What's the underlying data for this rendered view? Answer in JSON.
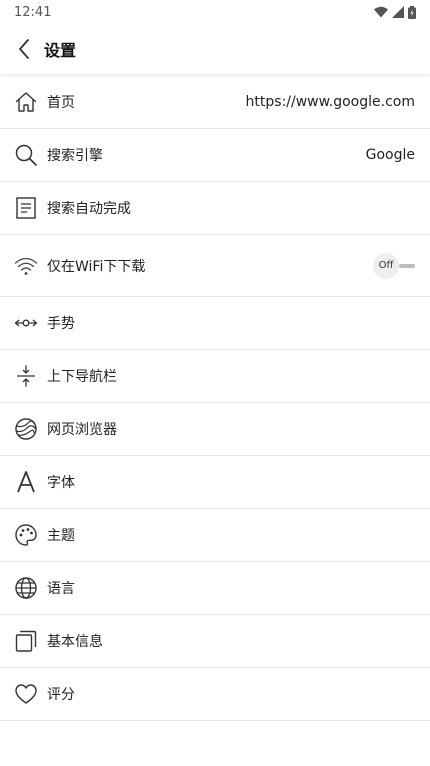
{
  "status_bar": {
    "time": "12:41"
  },
  "header": {
    "title": "设置"
  },
  "settings": {
    "homepage": {
      "label": "首页",
      "value": "https://www.google.com"
    },
    "search_engine": {
      "label": "搜索引擎",
      "value": "Google"
    },
    "search_autocomplete": {
      "label": "搜索自动完成"
    },
    "wifi_only_download": {
      "label": "仅在WiFi下下载",
      "toggle_text": "Off",
      "enabled": false
    },
    "gestures": {
      "label": "手势"
    },
    "navigation_bars": {
      "label": "上下导航栏"
    },
    "web_browser": {
      "label": "网页浏览器"
    },
    "font": {
      "label": "字体"
    },
    "theme": {
      "label": "主题"
    },
    "language": {
      "label": "语言"
    },
    "basic_info": {
      "label": "基本信息"
    },
    "rating": {
      "label": "评分"
    }
  }
}
